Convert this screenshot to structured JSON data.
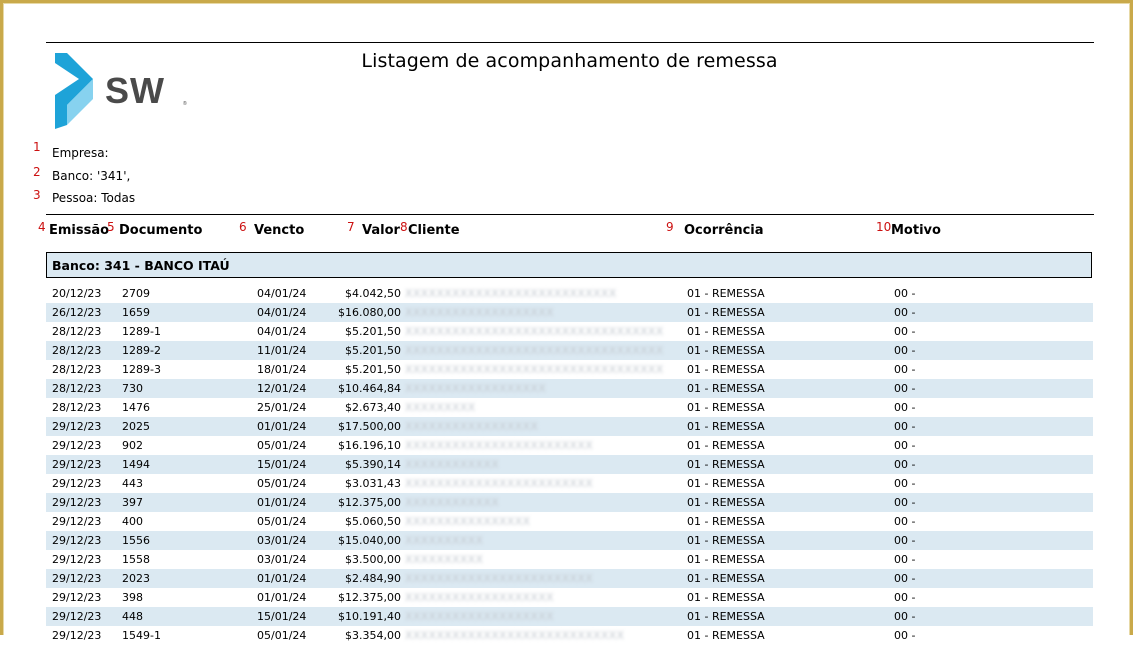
{
  "report": {
    "title": "Listagem de acompanhamento de remessa",
    "empresa_label": "Empresa:",
    "banco_label": "Banco: '341',",
    "pessoa_label": "Pessoa: Todas"
  },
  "markers": [
    "1",
    "2",
    "3",
    "4",
    "5",
    "6",
    "7",
    "8",
    "9",
    "10"
  ],
  "columns": {
    "emissao": "Emissão",
    "documento": "Documento",
    "vencto": "Vencto",
    "valor": "Valor",
    "cliente": "Cliente",
    "ocorrencia": "Ocorrência",
    "motivo": "Motivo"
  },
  "bank_group": "Banco: 341 - BANCO ITAÚ",
  "colors": {
    "logo_blue": "#1ea3d8",
    "logo_gray": "#4a4a4a",
    "row_alt": "#dbe9f2",
    "marker_red": "#cc1111",
    "frame": "#c9a94a"
  },
  "rows": [
    {
      "emissao": "20/12/23",
      "documento": "2709",
      "vencto": "04/01/24",
      "valor": "$4.042,50",
      "cliente": "XXXXXXXXXXXXXXXXXXXXXXXXXXX",
      "ocorrencia": "01 - REMESSA",
      "motivo": "00 -"
    },
    {
      "emissao": "26/12/23",
      "documento": "1659",
      "vencto": "04/01/24",
      "valor": "$16.080,00",
      "cliente": "XXXXXXXXXXXXXXXXXXX",
      "ocorrencia": "01 - REMESSA",
      "motivo": "00 -"
    },
    {
      "emissao": "28/12/23",
      "documento": "1289-1",
      "vencto": "04/01/24",
      "valor": "$5.201,50",
      "cliente": "XXXXXXXXXXXXXXXXXXXXXXXXXXXXXXXXX",
      "ocorrencia": "01 - REMESSA",
      "motivo": "00 -"
    },
    {
      "emissao": "28/12/23",
      "documento": "1289-2",
      "vencto": "11/01/24",
      "valor": "$5.201,50",
      "cliente": "XXXXXXXXXXXXXXXXXXXXXXXXXXXXXXXXX",
      "ocorrencia": "01 - REMESSA",
      "motivo": "00 -"
    },
    {
      "emissao": "28/12/23",
      "documento": "1289-3",
      "vencto": "18/01/24",
      "valor": "$5.201,50",
      "cliente": "XXXXXXXXXXXXXXXXXXXXXXXXXXXXXXXXX",
      "ocorrencia": "01 - REMESSA",
      "motivo": "00 -"
    },
    {
      "emissao": "28/12/23",
      "documento": "730",
      "vencto": "12/01/24",
      "valor": "$10.464,84",
      "cliente": "XXXXXXXXXXXXXXXXXX",
      "ocorrencia": "01 - REMESSA",
      "motivo": "00 -"
    },
    {
      "emissao": "28/12/23",
      "documento": "1476",
      "vencto": "25/01/24",
      "valor": "$2.673,40",
      "cliente": "XXXXXXXXX",
      "ocorrencia": "01 - REMESSA",
      "motivo": "00 -"
    },
    {
      "emissao": "29/12/23",
      "documento": "2025",
      "vencto": "01/01/24",
      "valor": "$17.500,00",
      "cliente": "XXXXXXXXXXXXXXXXX",
      "ocorrencia": "01 - REMESSA",
      "motivo": "00 -"
    },
    {
      "emissao": "29/12/23",
      "documento": "902",
      "vencto": "05/01/24",
      "valor": "$16.196,10",
      "cliente": "XXXXXXXXXXXXXXXXXXXXXXXX",
      "ocorrencia": "01 - REMESSA",
      "motivo": "00 -"
    },
    {
      "emissao": "29/12/23",
      "documento": "1494",
      "vencto": "15/01/24",
      "valor": "$5.390,14",
      "cliente": "XXXXXXXXXXXX",
      "ocorrencia": "01 - REMESSA",
      "motivo": "00 -"
    },
    {
      "emissao": "29/12/23",
      "documento": "443",
      "vencto": "05/01/24",
      "valor": "$3.031,43",
      "cliente": "XXXXXXXXXXXXXXXXXXXXXXXX",
      "ocorrencia": "01 - REMESSA",
      "motivo": "00 -"
    },
    {
      "emissao": "29/12/23",
      "documento": "397",
      "vencto": "01/01/24",
      "valor": "$12.375,00",
      "cliente": "XXXXXXXXXXXX",
      "ocorrencia": "01 - REMESSA",
      "motivo": "00 -"
    },
    {
      "emissao": "29/12/23",
      "documento": "400",
      "vencto": "05/01/24",
      "valor": "$5.060,50",
      "cliente": "XXXXXXXXXXXXXXXX",
      "ocorrencia": "01 - REMESSA",
      "motivo": "00 -"
    },
    {
      "emissao": "29/12/23",
      "documento": "1556",
      "vencto": "03/01/24",
      "valor": "$15.040,00",
      "cliente": "XXXXXXXXXX",
      "ocorrencia": "01 - REMESSA",
      "motivo": "00 -"
    },
    {
      "emissao": "29/12/23",
      "documento": "1558",
      "vencto": "03/01/24",
      "valor": "$3.500,00",
      "cliente": "XXXXXXXXXX",
      "ocorrencia": "01 - REMESSA",
      "motivo": "00 -"
    },
    {
      "emissao": "29/12/23",
      "documento": "2023",
      "vencto": "01/01/24",
      "valor": "$2.484,90",
      "cliente": "XXXXXXXXXXXXXXXXXXXXXXXX",
      "ocorrencia": "01 - REMESSA",
      "motivo": "00 -"
    },
    {
      "emissao": "29/12/23",
      "documento": "398",
      "vencto": "01/01/24",
      "valor": "$12.375,00",
      "cliente": "XXXXXXXXXXXXXXXXXXX",
      "ocorrencia": "01 - REMESSA",
      "motivo": "00 -"
    },
    {
      "emissao": "29/12/23",
      "documento": "448",
      "vencto": "15/01/24",
      "valor": "$10.191,40",
      "cliente": "XXXXXXXXXXXXXXXXXXX",
      "ocorrencia": "01 - REMESSA",
      "motivo": "00 -"
    },
    {
      "emissao": "29/12/23",
      "documento": "1549-1",
      "vencto": "05/01/24",
      "valor": "$3.354,00",
      "cliente": "XXXXXXXXXXXXXXXXXXXXXXXXXXXX",
      "ocorrencia": "01 - REMESSA",
      "motivo": "00 -"
    }
  ]
}
